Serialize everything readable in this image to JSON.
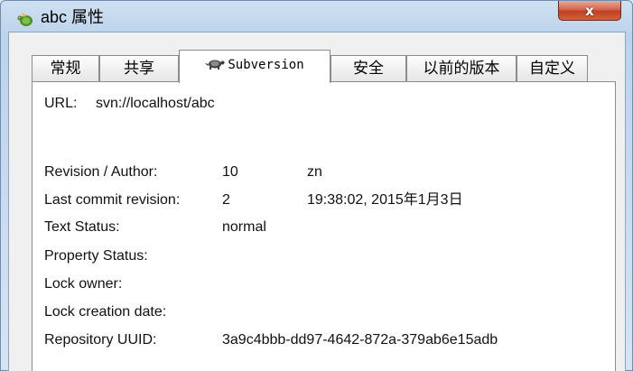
{
  "window": {
    "title": "abc 属性",
    "close_label": "x"
  },
  "tabs": [
    {
      "label": "常规",
      "active": false
    },
    {
      "label": "共享",
      "active": false
    },
    {
      "label": "Subversion",
      "active": true,
      "icon": "tortoise-svn-icon"
    },
    {
      "label": "安全",
      "active": false
    },
    {
      "label": "以前的版本",
      "active": false
    },
    {
      "label": "自定义",
      "active": false
    }
  ],
  "panel": {
    "url_label": "URL:",
    "url_value": "svn://localhost/abc",
    "rows": [
      {
        "label": "Revision / Author:",
        "value1": "10",
        "value2": "zn"
      },
      {
        "label": "Last commit revision:",
        "value1": "2",
        "value2": "19:38:02, 2015年1月3日"
      },
      {
        "label": "Text Status:",
        "value1": "normal",
        "value2": ""
      },
      {
        "label": "Property Status:",
        "value1": "",
        "value2": ""
      },
      {
        "label": "Lock owner:",
        "value1": "",
        "value2": ""
      },
      {
        "label": "Lock creation date:",
        "value1": "",
        "value2": ""
      },
      {
        "label": "Repository UUID:",
        "value1": "3a9c4bbb-dd97-4642-872a-379ab6e15adb",
        "value2": ""
      }
    ]
  },
  "colors": {
    "title_bar": "#bcd3eb",
    "close_button": "#c1401f",
    "panel_background": "#ffffff"
  }
}
